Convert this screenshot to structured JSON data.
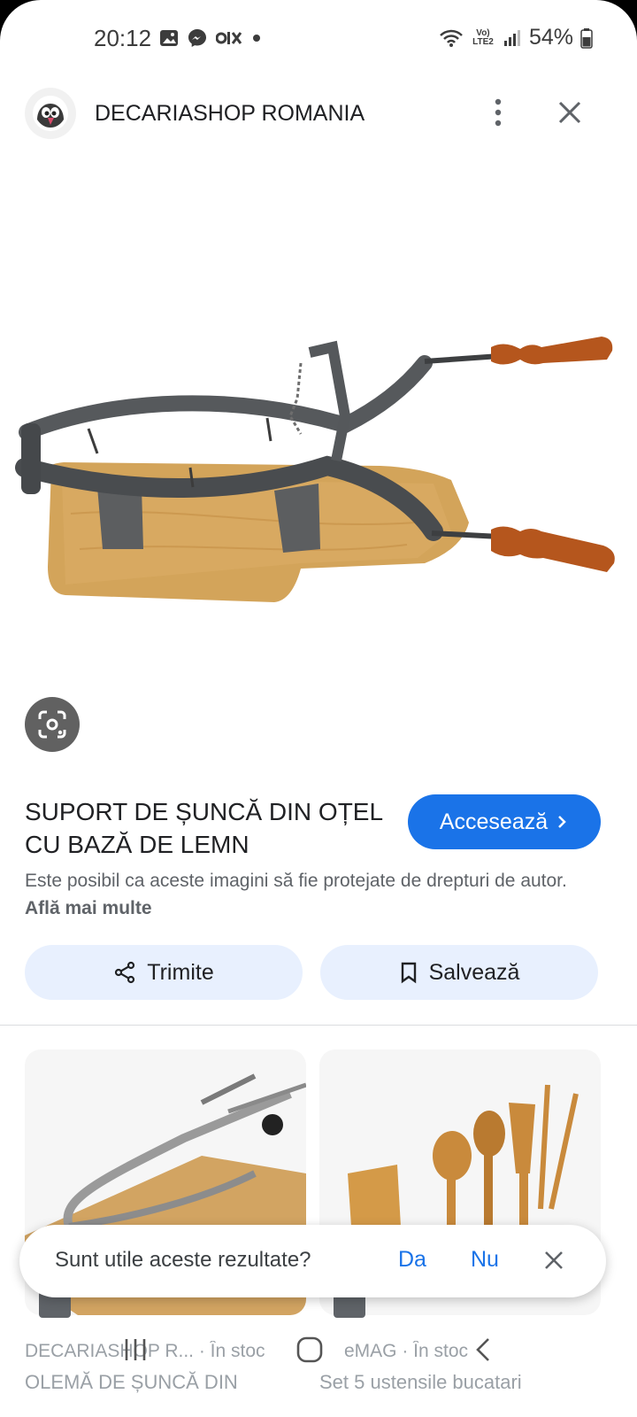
{
  "status_bar": {
    "time": "20:12",
    "network": "Vo) LTE2",
    "battery": "54%",
    "icons": [
      "gallery-icon",
      "messenger-icon",
      "olx-icon",
      "dot-icon",
      "wifi-icon",
      "signal-icon",
      "battery-icon"
    ]
  },
  "header": {
    "site_name": "DECARIASHOP ROMANIA",
    "logo_icon": "prestashop-puffin-logo"
  },
  "product": {
    "image_alt": "steel ham holder on wooden board",
    "title": "SUPORT DE ȘUNCĂ DIN OȚEL CU BAZĂ DE LEMN",
    "visit_label": "Accesează",
    "copyright_text": "Este posibil ca aceste imagini să fie protejate de drepturi de autor.",
    "learn_more": "Află mai multe"
  },
  "actions": {
    "share_label": "Trimite",
    "save_label": "Salvează"
  },
  "related": [
    {
      "meta": "DECARIASHOP R... · În stoc",
      "title": "OLEMĂ DE ȘUNCĂ DIN"
    },
    {
      "meta": "eMAG · În stoc",
      "title": "Set 5 ustensile bucatari"
    }
  ],
  "feedback": {
    "question": "Sunt utile aceste rezultate?",
    "yes": "Da",
    "no": "Nu"
  },
  "colors": {
    "accent": "#1a73e8",
    "action_bg": "#e8f0fe",
    "lens_bg": "#616161"
  }
}
